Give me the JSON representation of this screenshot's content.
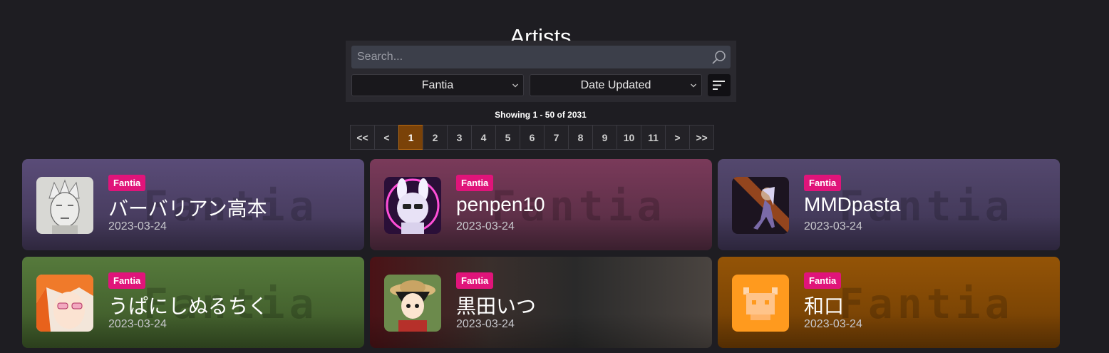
{
  "page": {
    "title": "Artists"
  },
  "search": {
    "placeholder": "Search...",
    "value": "",
    "service_selected": "Fantia",
    "sort_selected": "Date Updated"
  },
  "pagination": {
    "showing": "Showing 1 - 50 of 2031",
    "first": "<<",
    "prev": "<",
    "pages": [
      "1",
      "2",
      "3",
      "4",
      "5",
      "6",
      "7",
      "8",
      "9",
      "10",
      "11"
    ],
    "current": "1",
    "next": ">",
    "last": ">>"
  },
  "cards": [
    {
      "service": "Fantia",
      "name": "バーバリアン高本",
      "date": "2023-03-24",
      "watermark": "Fantia",
      "bg": "#4e4266"
    },
    {
      "service": "Fantia",
      "name": "penpen10",
      "date": "2023-03-24",
      "watermark": "Fantia",
      "bg": "#6d3350"
    },
    {
      "service": "Fantia",
      "name": "MMDpasta",
      "date": "2023-03-24",
      "watermark": "Fantia",
      "bg": "#4a3f60"
    },
    {
      "service": "Fantia",
      "name": "うぱにしぬるちく",
      "date": "2023-03-24",
      "watermark": "Fantia",
      "bg": "#4b6b34"
    },
    {
      "service": "Fantia",
      "name": "黒田いつ",
      "date": "2023-03-24",
      "watermark": "",
      "bg": "#3a2a2e"
    },
    {
      "service": "Fantia",
      "name": "和口",
      "date": "2023-03-24",
      "watermark": "Fantia",
      "bg": "#8a4d06"
    }
  ],
  "colors": {
    "background": "#1e1d22",
    "badge": "#e0147a",
    "active_page": "#7a4208"
  },
  "icons": {
    "search": "search-icon",
    "chevron": "chevron-down-icon",
    "sort": "sort-direction-icon"
  }
}
